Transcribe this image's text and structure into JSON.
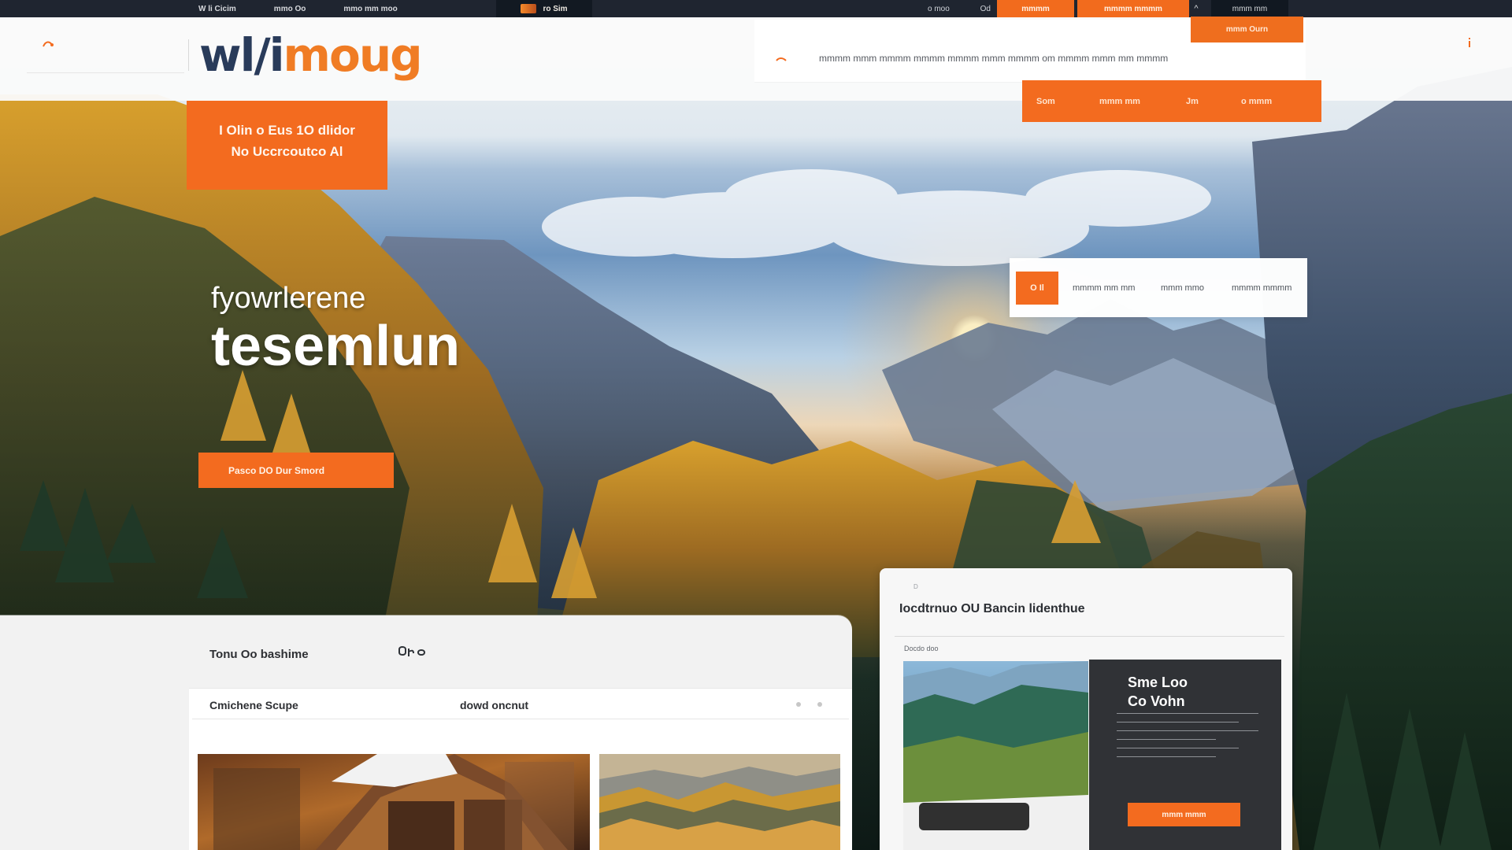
{
  "brand": {
    "logo_part_1": "wl/i",
    "logo_part_2": "moug"
  },
  "topbar": {
    "links": [
      "W li Cicim",
      "mmo Oo",
      "mmo mm moo"
    ],
    "active_tab": "ro Sim",
    "status_label": "o moo",
    "status_suffix": "Od",
    "button_1": "mmmm",
    "button_2": "mmmm mmmm",
    "arrow_label": "^",
    "right_box_label": "mmm mm"
  },
  "header": {
    "search_text": "mmmm mmm mmmm mmmm mmmm mmm mmmm om mmmm mmm mm mmmm",
    "search_button": "mmm Ourn",
    "nav_items": [
      "Som",
      "mmm mm",
      "Jm",
      "o mmm"
    ]
  },
  "hero": {
    "badge_line_1": "I Olin o Eus 1O dlidor",
    "badge_line_2": "No Uccrcoutco Al",
    "subtitle": "fyowrlerene",
    "title": "tesemlun",
    "cta_label": "Pasco DO Dur Smord"
  },
  "filters": {
    "pill_label": "O Il",
    "labels": [
      "mmmm mm mm",
      "mmm mmo",
      "mmmm mmmm"
    ]
  },
  "tour": {
    "heading": "Tonu Oo bashime",
    "col_a": "Cmichene Scupe",
    "col_b": "dowd oncnut"
  },
  "detail": {
    "caption_top": "D",
    "title": "Iocdtrnuo OU Bancin lidenthue",
    "caption": "Docdo doo",
    "promo_title_line_1": "Sme Loo",
    "promo_title_line_2": "Co Vohn",
    "promo_button": "mmm mmm"
  },
  "theme": {
    "accent": "#f36b1f",
    "navy": "#293b5a"
  },
  "icons": {
    "left_top": "nav-icon",
    "search": "pin-icon",
    "chat": "chat-icon",
    "right_top": "info-icon"
  }
}
